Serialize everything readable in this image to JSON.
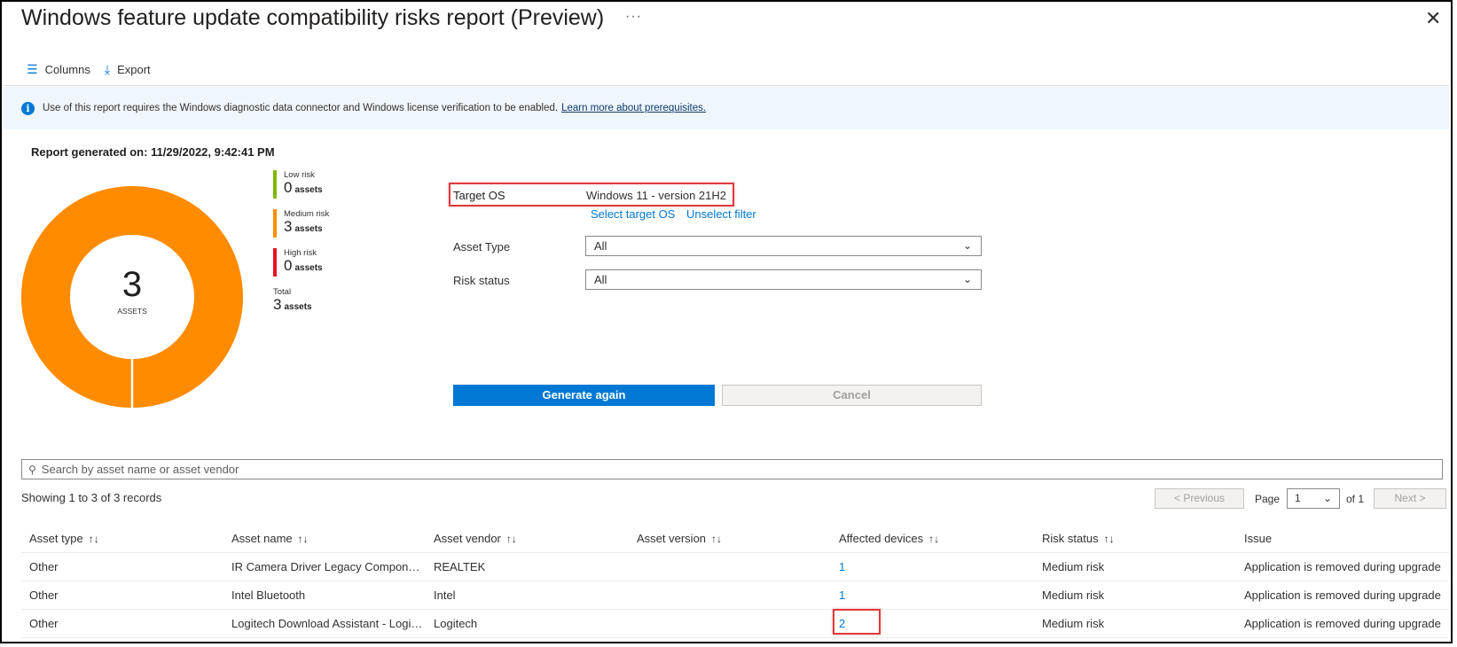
{
  "header": {
    "title": "Windows feature update compatibility risks report (Preview)",
    "more": "···",
    "close": "✕"
  },
  "toolbar": {
    "columns_label": "Columns",
    "columns_icon": "columns-icon",
    "export_label": "Export",
    "export_icon": "download-icon"
  },
  "banner": {
    "text": "Use of this report requires the Windows diagnostic data connector and Windows license verification to be enabled.",
    "link": "Learn more about prerequisites.",
    "icon": "info-icon"
  },
  "report": {
    "generated": "Report generated on: 11/29/2022, 9:42:41 PM"
  },
  "donut": {
    "total": "3",
    "unit": "ASSETS",
    "color": "#ff8c00"
  },
  "legend": {
    "low": {
      "label": "Low risk",
      "count": "0",
      "unit": "assets",
      "color": "#7fba00"
    },
    "medium": {
      "label": "Medium risk",
      "count": "3",
      "unit": "assets",
      "color": "#ff8c00"
    },
    "high": {
      "label": "High risk",
      "count": "0",
      "unit": "assets",
      "color": "#e81123"
    },
    "total": {
      "label": "Total",
      "count": "3",
      "unit": "assets"
    }
  },
  "filters": {
    "target_os_label": "Target OS",
    "target_os_value": "Windows 11 - version 21H2",
    "select_target_os": "Select target OS",
    "unselect_filter": "Unselect filter",
    "asset_type_label": "Asset Type",
    "asset_type_value": "All",
    "risk_status_label": "Risk status",
    "risk_status_value": "All"
  },
  "actions": {
    "generate_again": "Generate again",
    "cancel": "Cancel"
  },
  "search": {
    "placeholder": "Search by asset name or asset vendor"
  },
  "pagination": {
    "showing": "Showing 1 to 3 of 3 records",
    "previous": "< Previous",
    "page_label": "Page",
    "page_value": "1",
    "of_label": "of 1",
    "next": "Next >"
  },
  "table": {
    "columns": [
      "Asset type",
      "Asset name",
      "Asset vendor",
      "Asset version",
      "Affected devices",
      "Risk status",
      "Issue"
    ],
    "sort_glyph": "↑↓",
    "rows": [
      [
        "Other",
        "IR Camera Driver Legacy Components",
        "REALTEK",
        "",
        "1",
        "Medium risk",
        "Application is removed during upgrade"
      ],
      [
        "Other",
        "Intel Bluetooth",
        "Intel",
        "",
        "1",
        "Medium risk",
        "Application is removed during upgrade"
      ],
      [
        "Other",
        "Logitech Download Assistant - LogiLDA",
        "Logitech",
        "",
        "2",
        "Medium risk",
        "Application is removed during upgrade"
      ]
    ]
  }
}
